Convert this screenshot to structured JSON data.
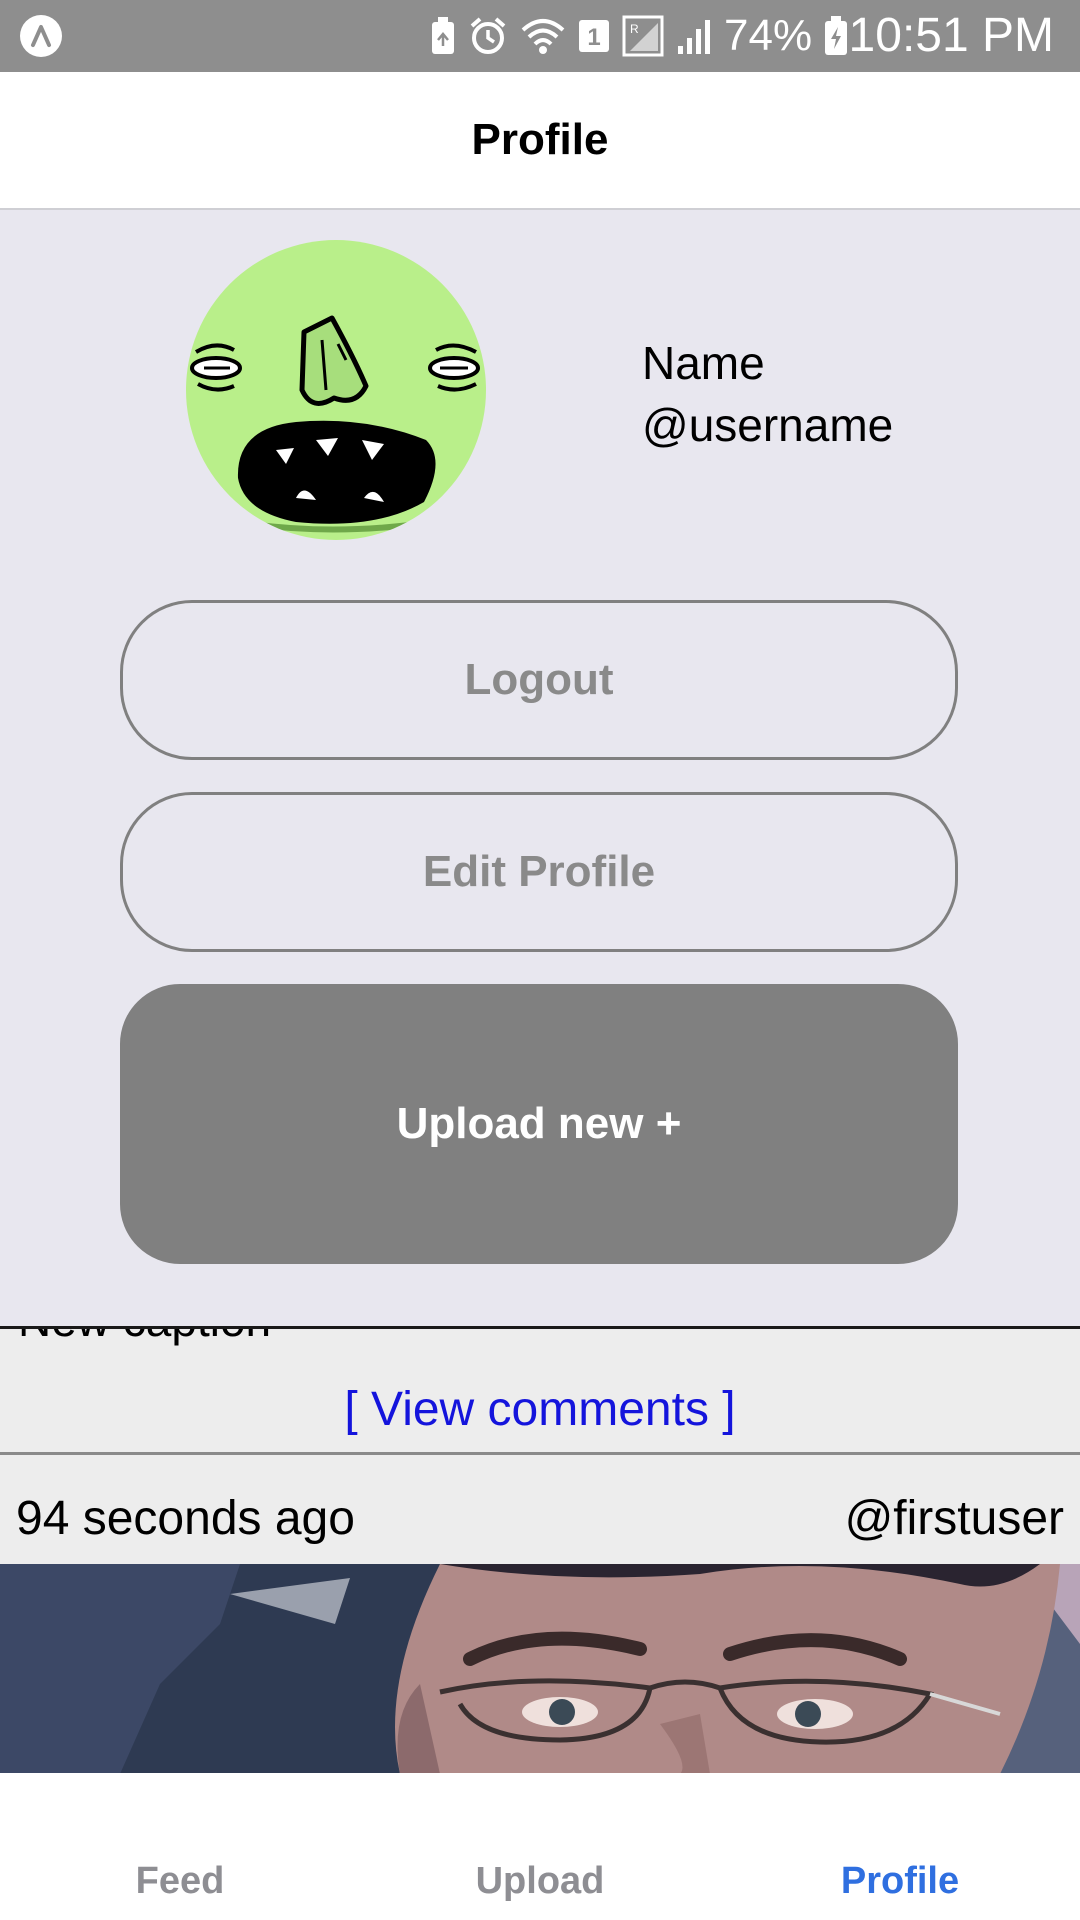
{
  "status_bar": {
    "battery": "74%",
    "sim_slot": "1",
    "time": "10:51 PM",
    "icons": [
      "app-notification-icon",
      "battery-saver-icon",
      "alarm-icon",
      "wifi-icon",
      "sim-icon",
      "roaming-signal-icon",
      "signal-icon",
      "battery-charging-icon"
    ]
  },
  "header": {
    "title": "Profile"
  },
  "profile": {
    "name": "Name",
    "username": "@username",
    "avatar_icon": "monster-face-avatar",
    "logout_label": "Logout",
    "edit_label": "Edit Profile",
    "upload_label": "Upload new +"
  },
  "feed": {
    "caption_partial": "New caption",
    "view_comments": "[ View comments ]",
    "post": {
      "time": "94 seconds ago",
      "user": "@firstuser"
    }
  },
  "tabs": {
    "feed": "Feed",
    "upload": "Upload",
    "profile": "Profile",
    "active": "Profile"
  },
  "colors": {
    "status_bar": "#8e8e8e",
    "panel_bg": "#e8e7ef",
    "upload_button": "#808080",
    "link": "#1414dc",
    "active_tab": "#2f6fe0",
    "avatar_green": "#b9ef8a"
  }
}
